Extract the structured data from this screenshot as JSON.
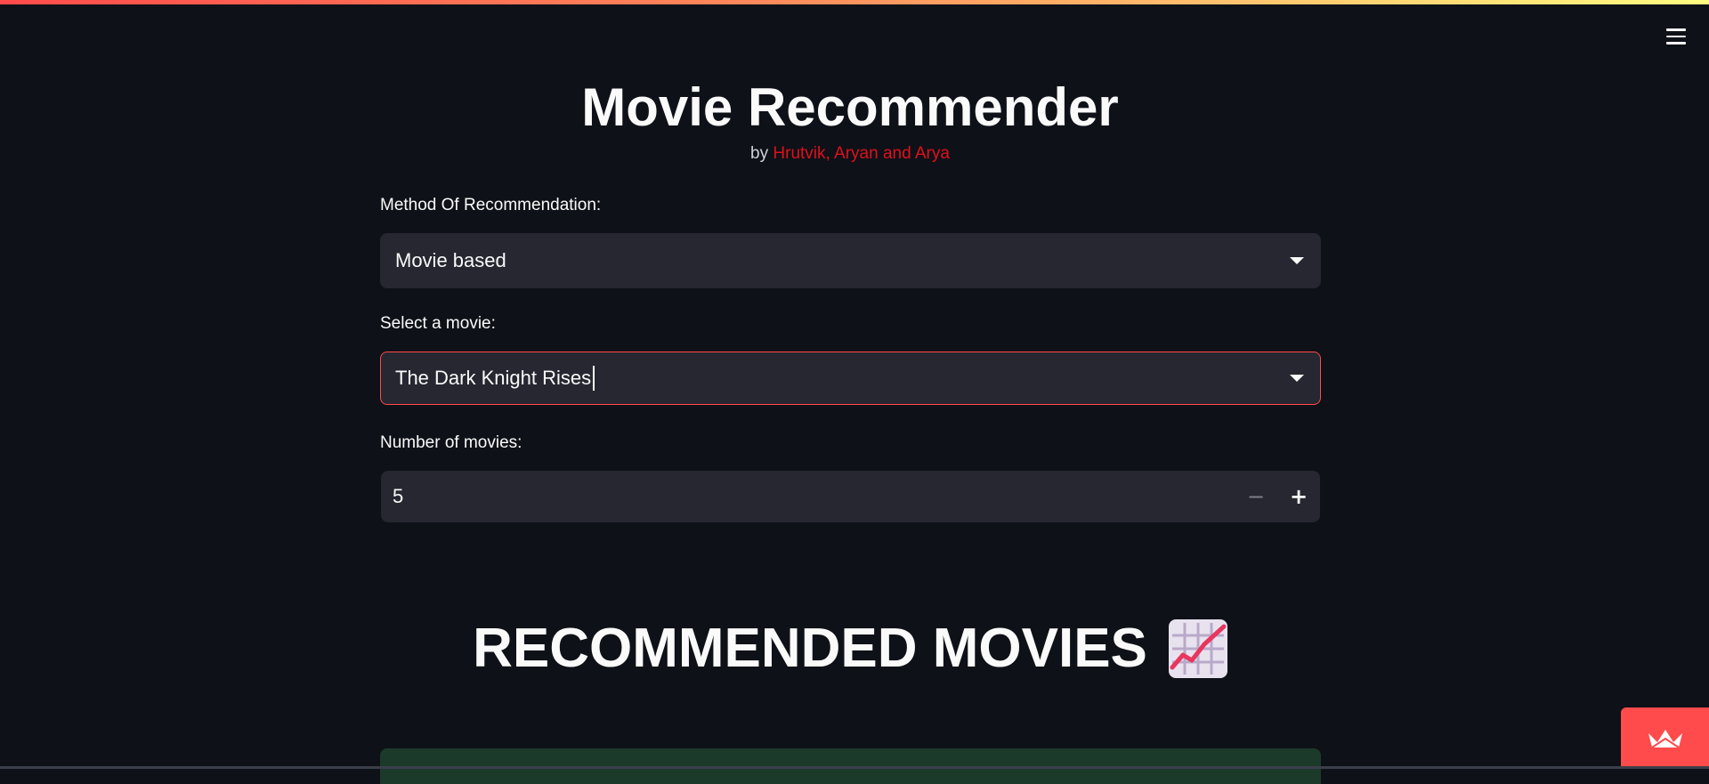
{
  "app": {
    "title": "Movie Recommender",
    "subtitle_prefix": "by ",
    "authors": "Hrutvik, Aryan and Arya",
    "accent_color": "#ff4b4b",
    "background_color": "#0e1117"
  },
  "form": {
    "method_label": "Method Of Recommendation:",
    "method_value": "Movie based",
    "movie_label": "Select a movie:",
    "movie_value": "The Dark Knight Rises",
    "count_label": "Number of movies:",
    "count_value": "5",
    "decrement_symbol": "−",
    "increment_symbol": "+"
  },
  "results": {
    "heading": "RECOMMENDED MOVIES",
    "heading_icon": "chart-increasing-icon"
  },
  "icons": {
    "menu": "hamburger-menu-icon",
    "dropdown": "chevron-down-icon",
    "deploy": "streamlit-crown-icon"
  }
}
